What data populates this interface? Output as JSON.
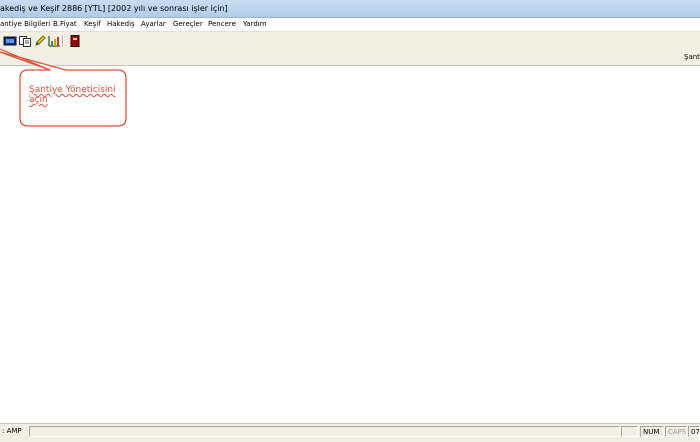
{
  "window": {
    "title": "akediş ve Keşif 2886 [YTL] [2002 yılı ve sonrası işler için]"
  },
  "menu": {
    "items": [
      {
        "label": "antiye Bilgileri"
      },
      {
        "label": "B.Fiyat"
      },
      {
        "label": "Keşif"
      },
      {
        "label": "Hakediş"
      },
      {
        "label": "Ayarlar"
      },
      {
        "label": "Gereçler"
      },
      {
        "label": "Pencere"
      },
      {
        "label": "Yardım"
      }
    ]
  },
  "toolbar": {
    "icons": [
      "monitor-icon",
      "copy-pages-icon",
      "pencil-icon",
      "chart-icon",
      "book-icon"
    ]
  },
  "subbar": {
    "right_label": "Şant"
  },
  "callout": {
    "line1": "Şantiye Yöneticisini",
    "line2": "açın",
    "color": "#e0523b"
  },
  "statusbar": {
    "left": ": AMP",
    "num": "NUM",
    "caps": "CAPS",
    "last": "07."
  }
}
